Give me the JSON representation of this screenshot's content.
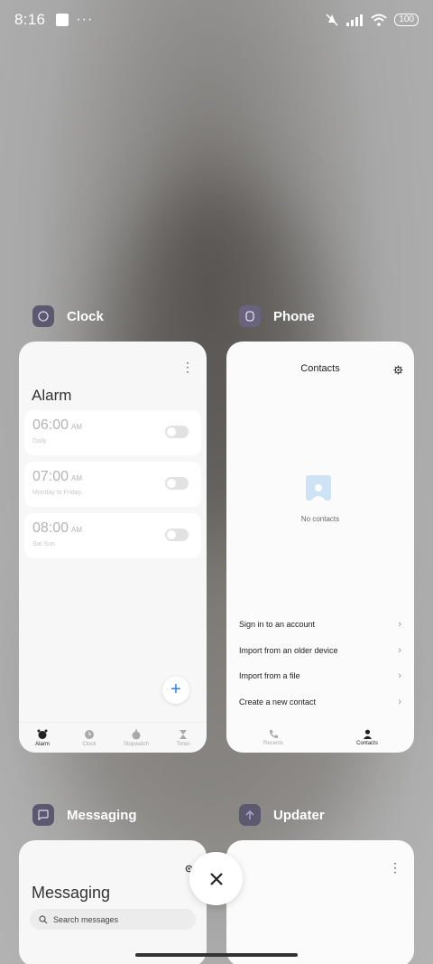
{
  "status_bar": {
    "time": "8:16",
    "dots": "···",
    "battery": "100"
  },
  "apps": {
    "clock": {
      "label": "Clock",
      "screen_title": "Alarm",
      "alarms": [
        {
          "time": "06:00",
          "ampm": "AM",
          "repeat": "Daily"
        },
        {
          "time": "07:00",
          "ampm": "AM",
          "repeat": "Monday to Friday"
        },
        {
          "time": "08:00",
          "ampm": "AM",
          "repeat": "Sat Sun"
        }
      ],
      "tabs": [
        "Alarm",
        "Clock",
        "Stopwatch",
        "Timer"
      ]
    },
    "phone": {
      "label": "Phone",
      "screen_title": "Contacts",
      "empty_text": "No contacts",
      "menu": [
        "Sign in to an account",
        "Import from an older device",
        "Import from a file",
        "Create a new contact"
      ],
      "tabs": [
        "Recents",
        "Contacts"
      ]
    },
    "messaging": {
      "label": "Messaging",
      "screen_title": "Messaging",
      "search_placeholder": "Search messages"
    },
    "updater": {
      "label": "Updater"
    }
  },
  "icons": {
    "close": "close-icon",
    "wifi": "wifi-icon",
    "signal": "signal-icon",
    "silent": "silent-icon"
  }
}
